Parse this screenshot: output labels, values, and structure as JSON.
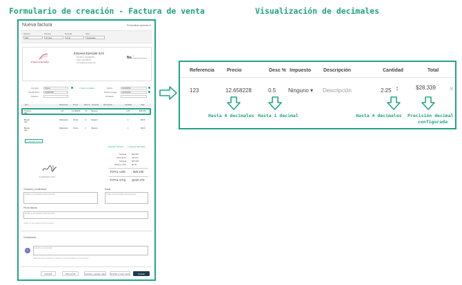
{
  "headings": {
    "left": "Formulario de creación - Factura de venta",
    "right": "Visualización de decimales"
  },
  "invoice": {
    "title": "Nueva factura",
    "preferences": "Personalizar opciones ⚙",
    "fields": [
      {
        "label": "Número",
        "value": "ABC"
      },
      {
        "label": "Período",
        "value": "30 días"
      },
      {
        "label": "Moneda",
        "value": "GTQ"
      },
      {
        "label": "Tasa",
        "value": "Quetzales"
      }
    ],
    "company_logo_text": "Empresa Ejemplar",
    "company_name": "Empresa Ejemplar SAS",
    "company_lines": [
      "NIT/RUT 123456789",
      "Calle 123 #45-67",
      "correo@empresa.com"
    ],
    "number_label": "No.",
    "number_value": "1",
    "client_labels": [
      "Contacto",
      "Identificación",
      "Teléfono"
    ],
    "client_values": [
      "Cliente",
      "123456789",
      ""
    ],
    "new_contact": "+ Nuevo contacto",
    "date_labels": [
      "Fecha",
      "Fecha de pago",
      "Vendedor"
    ],
    "date_values": [
      "01/10/2024",
      "01/10/2024",
      ""
    ],
    "table_headers": [
      "Ítem",
      "Referencia",
      "Precio",
      "Desc %",
      "Impuesto",
      "Descripción",
      "Cantidad",
      "Total"
    ],
    "rows": [
      {
        "item": "Producto 001",
        "ref": "123",
        "price": "12.658228",
        "desc": "0.5",
        "tax": "Ninguno",
        "qty": "2.25",
        "total": "$28.339"
      },
      {
        "item": "Buscar ítem",
        "ref": "Referencia",
        "price": "Precio",
        "desc": "0",
        "tax": "Ninguno",
        "qty": "1",
        "total": "$0.00"
      },
      {
        "item": "Buscar ítem",
        "ref": "Referencia",
        "price": "Precio",
        "desc": "0",
        "tax": "Ninguno",
        "qty": "1",
        "total": "$0.00"
      }
    ],
    "add_line": "+ Agregar línea",
    "add_retention": "+ Agregar retención",
    "add_discount": "+ Agregar descuento",
    "signature_name": "ELABORADO POR",
    "totals": [
      {
        "label": "Subtotal",
        "value": "$28.481"
      },
      {
        "label": "Descuento",
        "value": "-$0.142"
      },
      {
        "label": "Subtotal",
        "value": "$28.339"
      },
      {
        "label": "Ninguno (0%)",
        "value": "$0.00"
      }
    ],
    "total_usd_label": "TOTAL USD",
    "total_usd_value": "$28.339",
    "total_gtq_label": "TOTAL GTQ",
    "total_gtq_value": "Q220.475",
    "terms_label": "Términos y condiciones",
    "terms_placeholder": "Visible en la impresión del documento",
    "notes_label": "Notas",
    "notes_placeholder": "Visible en la impresión del documento",
    "footer_label": "Pie de factura",
    "footer_placeholder": "Visible en la impresión del documento",
    "footer_hint": "Visible en la impresión del documento",
    "comments_label": "Comentarios",
    "comment_placeholder": "Escribe un comentario",
    "comment_hint": "Utiliza @ para mencionar a usuarios. Los comentarios no se imprimen.",
    "avatar": "C",
    "buttons": [
      "Cancelar",
      "Vista previa",
      "Guardar y agregar pago",
      "Guardar y crear nueva",
      "Guardar"
    ]
  },
  "zoom": {
    "headers": [
      "Referencia",
      "Precio",
      "Desc %",
      "Impuesto",
      "Descripción",
      "Cantidad",
      "Total"
    ],
    "row": {
      "reference": "123",
      "price": "12.658228",
      "discount": "0.5",
      "tax": "Ninguno ▾",
      "description_placeholder": "Descripción",
      "quantity": "2.25",
      "total": "$28.339"
    },
    "annotations": {
      "price": "Hasta 6 decimales",
      "discount": "Hasta 1 decimal",
      "quantity": "Hasta 4 decimales",
      "total_line1": "Precisión decimal",
      "total_line2": "configurada"
    }
  },
  "colors": {
    "accent": "#1fa384",
    "heading": "#22a37c"
  }
}
